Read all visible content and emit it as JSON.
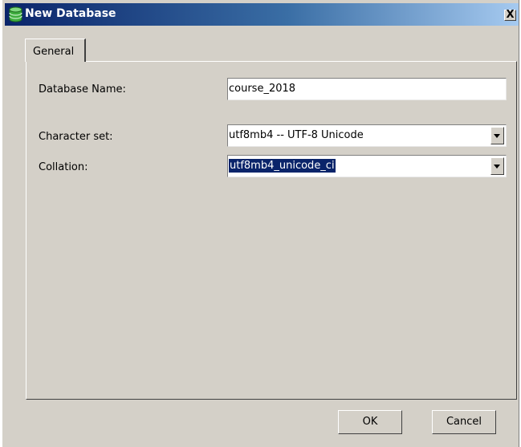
{
  "window": {
    "title": "New Database",
    "close_label": "X"
  },
  "tabs": [
    {
      "label": "General",
      "selected": true
    }
  ],
  "form": {
    "database_name_label": "Database Name:",
    "database_name_value": "course_2018",
    "character_set_label": "Character set:",
    "character_set_value": "utf8mb4 -- UTF-8 Unicode",
    "collation_label": "Collation:",
    "collation_value": "utf8mb4_unicode_ci"
  },
  "buttons": {
    "ok_label": "OK",
    "cancel_label": "Cancel"
  },
  "icons": {
    "title_icon": "database-icon",
    "dropdown_icon": "chevron-down-icon"
  },
  "colors": {
    "titlebar_start": "#0a246a",
    "titlebar_end": "#a6caf0",
    "dialog_background": "#d4d0c8",
    "selection": "#0a246a"
  }
}
